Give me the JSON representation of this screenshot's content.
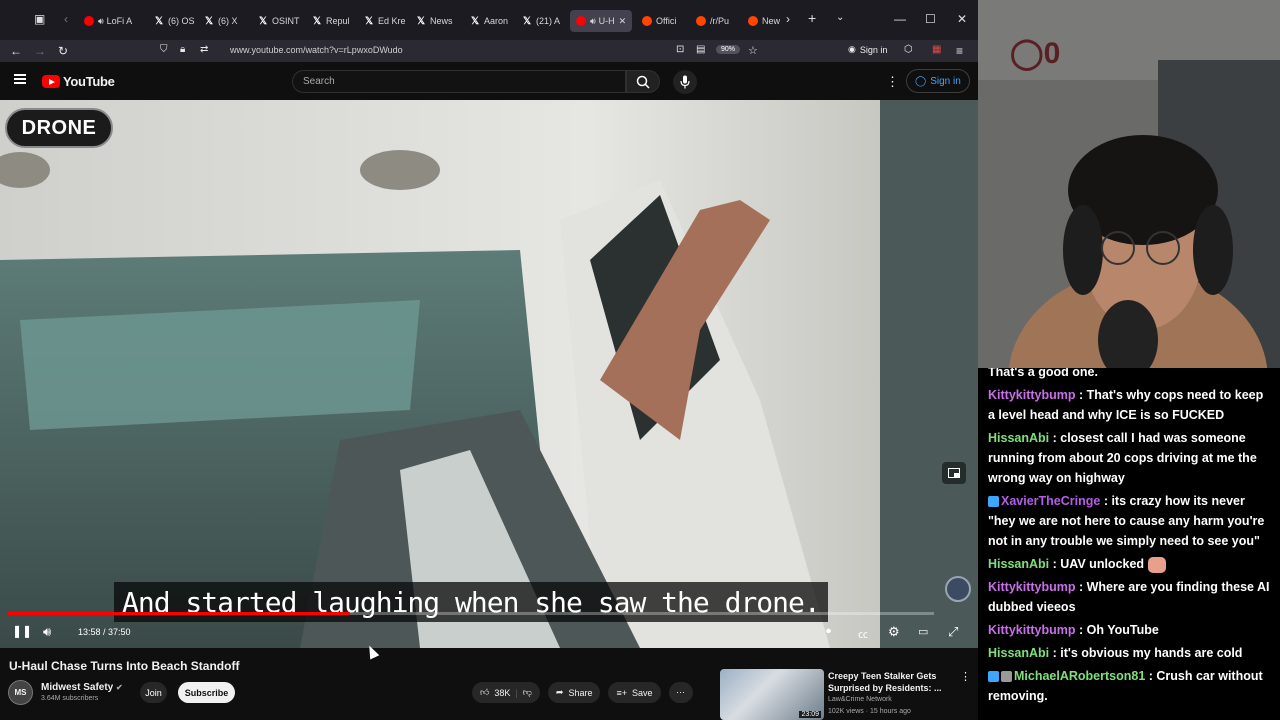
{
  "browser": {
    "tabs": [
      {
        "label": "LoFi A",
        "fav": "youtube",
        "color": "#ff0000",
        "speaker": true
      },
      {
        "label": "(6) OS",
        "fav": "x"
      },
      {
        "label": "(6) X",
        "fav": "x"
      },
      {
        "label": "OSINT",
        "fav": "x"
      },
      {
        "label": "Repul",
        "fav": "x"
      },
      {
        "label": "Ed Kre",
        "fav": "x"
      },
      {
        "label": "News",
        "fav": "x"
      },
      {
        "label": "Aaron",
        "fav": "x"
      },
      {
        "label": "(21) A",
        "fav": "x"
      },
      {
        "label": "U-H",
        "fav": "youtube",
        "color": "#ff0000",
        "speaker": true,
        "active": true
      },
      {
        "label": "Offici",
        "fav": "reddit",
        "color": "#ff4500"
      },
      {
        "label": "/r/Pu",
        "fav": "reddit",
        "color": "#ff4500"
      },
      {
        "label": "New",
        "fav": "reddit",
        "color": "#ff4500"
      }
    ],
    "url": "www.youtube.com/watch?v=rLpwxoDWudo",
    "zoom": "90%",
    "sign_in": "Sign in"
  },
  "youtube": {
    "logo_text": "YouTube",
    "search_placeholder": "Search",
    "sign_in": "Sign in"
  },
  "video": {
    "overlay_badge": "DRONE",
    "caption": "And started laughing when she saw the drone.",
    "current_time": "13:58",
    "duration": "37:50",
    "time_display": "13:58 / 37:50",
    "progress": 0.369,
    "title": "U-Haul Chase Turns Into Beach Standoff"
  },
  "channel": {
    "name": "Midwest Safety",
    "subscribers": "3.64M subscribers",
    "join": "Join",
    "subscribe": "Subscribe"
  },
  "actions": {
    "likes": "38K",
    "share": "Share",
    "save": "Save"
  },
  "recommendation": {
    "title": "Creepy Teen Stalker Gets Surprised by Residents: ...",
    "channel": "Law&Crime Network",
    "meta": "102K views · 15 hours ago",
    "duration": "23:09"
  },
  "chat": [
    {
      "user": "",
      "text": "That's a good one.",
      "partial": true
    },
    {
      "user": "Kittykittybump",
      "text": "That's why cops need to keep a level head and why ICE is so FUCKED",
      "color": "purple"
    },
    {
      "user": "HissanAbi",
      "text": "closest call I had was someone running from about 20 cops driving at me the wrong way on highway",
      "color": "green"
    },
    {
      "user": "XavierTheCringe",
      "text": "its crazy how its never \"hey we are not here to cause any harm you're not in any trouble we simply need to see you\"",
      "color": "violet",
      "badge": true
    },
    {
      "user": "HissanAbi",
      "text": "UAV unlocked",
      "color": "green",
      "emote": true
    },
    {
      "user": "Kittykittybump",
      "text": "Where are you finding these AI dubbed vieeos",
      "color": "purple"
    },
    {
      "user": "Kittykittybump",
      "text": "Oh YouTube",
      "color": "purple"
    },
    {
      "user": "HissanAbi",
      "text": "it's obvious my hands are cold",
      "color": "green"
    },
    {
      "user": "MichaelARobertson81",
      "text": "Crush car without removing.",
      "color": "green",
      "badges": true
    }
  ],
  "colors": {
    "youtube_red": "#ff0000",
    "link_blue": "#3ea6ff",
    "chat_purple": "#c96fe8",
    "chat_green": "#7fe07a"
  }
}
